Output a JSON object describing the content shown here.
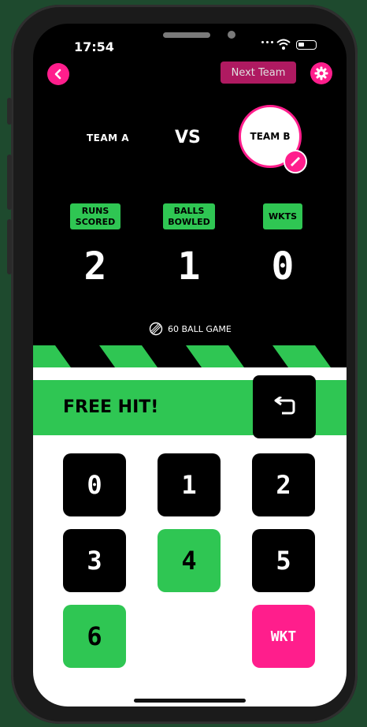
{
  "status_bar": {
    "time": "17:54"
  },
  "header": {
    "next_team_label": "Next Team"
  },
  "match": {
    "team_a": "TEAM A",
    "vs": "VS",
    "team_b": "TEAM B"
  },
  "stats": [
    {
      "label_line1": "RUNS",
      "label_line2": "SCORED",
      "value": "2"
    },
    {
      "label_line1": "BALLS",
      "label_line2": "BOWLED",
      "value": "1"
    },
    {
      "label_line1": "WKTS",
      "label_line2": "",
      "value": "0"
    }
  ],
  "game_type": "60 BALL GAME",
  "banner": {
    "text": "FREE HIT!"
  },
  "keypad": [
    "0",
    "1",
    "2",
    "3",
    "4",
    "5",
    "6",
    "WKT"
  ],
  "colors": {
    "accent_pink": "#ff1e8c",
    "accent_green": "#2fc653",
    "background": "#000000"
  },
  "icons": {
    "back": "chevron-left-icon",
    "settings": "gear-icon",
    "bat": "cricket-bat-icon",
    "game": "cricket-ball-icon",
    "undo": "undo-arrow-icon"
  }
}
